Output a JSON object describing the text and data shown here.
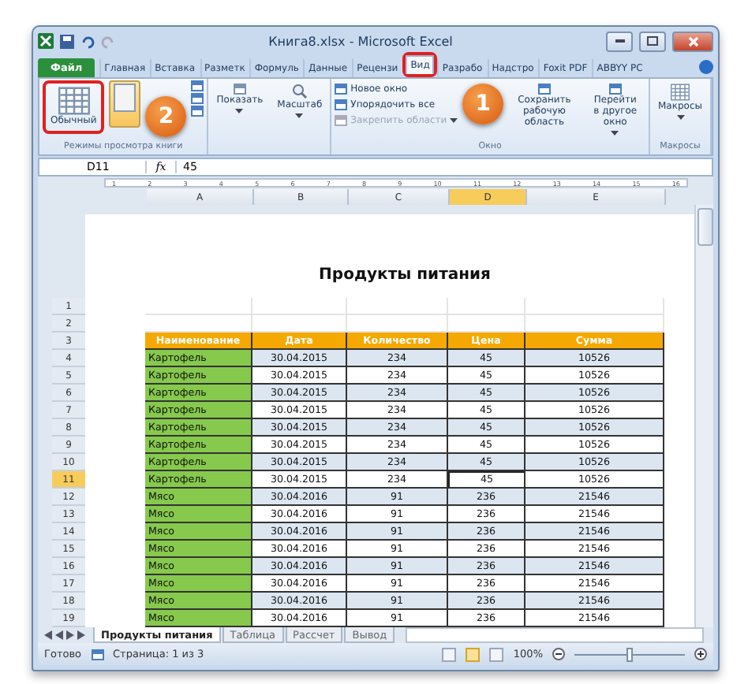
{
  "window": {
    "title": "Книга8.xlsx - Microsoft Excel"
  },
  "ribbon_tabs": [
    {
      "label": "Файл",
      "kind": "file",
      "selected": false,
      "highlighted": false
    },
    {
      "label": "Главная",
      "kind": "tab",
      "selected": false,
      "highlighted": false
    },
    {
      "label": "Вставка",
      "kind": "tab",
      "selected": false,
      "highlighted": false
    },
    {
      "label": "Разметк",
      "kind": "tab",
      "selected": false,
      "highlighted": false
    },
    {
      "label": "Формуль",
      "kind": "tab",
      "selected": false,
      "highlighted": false
    },
    {
      "label": "Данные",
      "kind": "tab",
      "selected": false,
      "highlighted": false
    },
    {
      "label": "Рецензи",
      "kind": "tab",
      "selected": false,
      "highlighted": false
    },
    {
      "label": "Вид",
      "kind": "tab",
      "selected": true,
      "highlighted": true
    },
    {
      "label": "Разрабо",
      "kind": "tab",
      "selected": false,
      "highlighted": false
    },
    {
      "label": "Надстро",
      "kind": "tab",
      "selected": false,
      "highlighted": false
    },
    {
      "label": "Foxit PDF",
      "kind": "tab",
      "selected": false,
      "highlighted": false
    },
    {
      "label": "ABBYY PC",
      "kind": "tab",
      "selected": false,
      "highlighted": false
    }
  ],
  "ribbon_groups": [
    {
      "kind": "views",
      "label": "Режимы просмотра книги",
      "buttons": [
        {
          "label": "Обычный",
          "selected": false,
          "highlighted": true
        },
        {
          "selected": true,
          "highlighted": false
        }
      ]
    },
    {
      "kind": "show",
      "buttons": [
        "Показать",
        "Масштаб"
      ]
    },
    {
      "kind": "window",
      "label": "Окно",
      "items": [
        {
          "label": "Новое окно",
          "disabled": false
        },
        {
          "label": "Упорядочить все",
          "disabled": false
        },
        {
          "label": "Закрепить области",
          "disabled": true
        }
      ],
      "big": [
        "Сохранить рабочую область",
        "Перейти в другое окно"
      ]
    },
    {
      "kind": "macros",
      "label": "Макросы",
      "button": "Макросы"
    }
  ],
  "formula_bar": {
    "name_box": "D11",
    "fx": "fx",
    "value": "45"
  },
  "ruler_marks": [
    "1",
    "2",
    "3",
    "4",
    "5",
    "6",
    "7",
    "8",
    "9",
    "10",
    "11",
    "12",
    "13",
    "14",
    "15",
    "16"
  ],
  "columns": [
    {
      "label": "A",
      "selected": false
    },
    {
      "label": "B",
      "selected": false
    },
    {
      "label": "C",
      "selected": false
    },
    {
      "label": "D",
      "selected": true
    },
    {
      "label": "E",
      "selected": false
    }
  ],
  "page_title": "Продукты питания",
  "rows": [
    {
      "number": "1",
      "kind": "blank",
      "selected": false
    },
    {
      "number": "2",
      "kind": "blank",
      "selected": false
    },
    {
      "number": "3",
      "kind": "header",
      "selected": false,
      "cells": [
        "Наименование",
        "Дата",
        "Количество",
        "Цена",
        "Сумма"
      ]
    },
    {
      "number": "4",
      "kind": "data",
      "selected": false,
      "cells": [
        "Картофель",
        "30.04.2015",
        "234",
        "45",
        "10526"
      ]
    },
    {
      "number": "5",
      "kind": "data",
      "selected": false,
      "cells": [
        "Картофель",
        "30.04.2015",
        "234",
        "45",
        "10526"
      ]
    },
    {
      "number": "6",
      "kind": "data",
      "selected": false,
      "cells": [
        "Картофель",
        "30.04.2015",
        "234",
        "45",
        "10526"
      ]
    },
    {
      "number": "7",
      "kind": "data",
      "selected": false,
      "cells": [
        "Картофель",
        "30.04.2015",
        "234",
        "45",
        "10526"
      ]
    },
    {
      "number": "8",
      "kind": "data",
      "selected": false,
      "cells": [
        "Картофель",
        "30.04.2015",
        "234",
        "45",
        "10526"
      ]
    },
    {
      "number": "9",
      "kind": "data",
      "selected": false,
      "cells": [
        "Картофель",
        "30.04.2015",
        "234",
        "45",
        "10526"
      ]
    },
    {
      "number": "10",
      "kind": "data",
      "selected": false,
      "cells": [
        "Картофель",
        "30.04.2015",
        "234",
        "45",
        "10526"
      ]
    },
    {
      "number": "11",
      "kind": "data",
      "selected": true,
      "cells": [
        "Картофель",
        "30.04.2015",
        "234",
        "45",
        "10526"
      ]
    },
    {
      "number": "12",
      "kind": "data",
      "selected": false,
      "cells": [
        "Мясо",
        "30.04.2016",
        "91",
        "236",
        "21546"
      ]
    },
    {
      "number": "13",
      "kind": "data",
      "selected": false,
      "cells": [
        "Мясо",
        "30.04.2016",
        "91",
        "236",
        "21546"
      ]
    },
    {
      "number": "14",
      "kind": "data",
      "selected": false,
      "cells": [
        "Мясо",
        "30.04.2016",
        "91",
        "236",
        "21546"
      ]
    },
    {
      "number": "15",
      "kind": "data",
      "selected": false,
      "cells": [
        "Мясо",
        "30.04.2016",
        "91",
        "236",
        "21546"
      ]
    },
    {
      "number": "16",
      "kind": "data",
      "selected": false,
      "cells": [
        "Мясо",
        "30.04.2016",
        "91",
        "236",
        "21546"
      ]
    },
    {
      "number": "17",
      "kind": "data",
      "selected": false,
      "cells": [
        "Мясо",
        "30.04.2016",
        "91",
        "236",
        "21546"
      ]
    },
    {
      "number": "18",
      "kind": "data",
      "selected": false,
      "cells": [
        "Мясо",
        "30.04.2016",
        "91",
        "236",
        "21546"
      ]
    },
    {
      "number": "19",
      "kind": "data",
      "selected": false,
      "cells": [
        "Мясо",
        "30.04.2016",
        "91",
        "236",
        "21546"
      ]
    }
  ],
  "sheet_tabs": [
    {
      "label": "Продукты питания",
      "selected": true
    },
    {
      "label": "Таблица",
      "selected": false
    },
    {
      "label": "Рассчет",
      "selected": false
    },
    {
      "label": "Вывод",
      "selected": false
    }
  ],
  "status_bar": {
    "ready": "Готово",
    "page": "Страница: 1 из 3",
    "views": [
      {
        "selected": false
      },
      {
        "selected": true
      },
      {
        "selected": false
      }
    ],
    "zoom": "100%",
    "zoom_slider": {
      "level": 0.5
    }
  },
  "annotations": [
    {
      "label": "1"
    },
    {
      "label": "2"
    }
  ]
}
